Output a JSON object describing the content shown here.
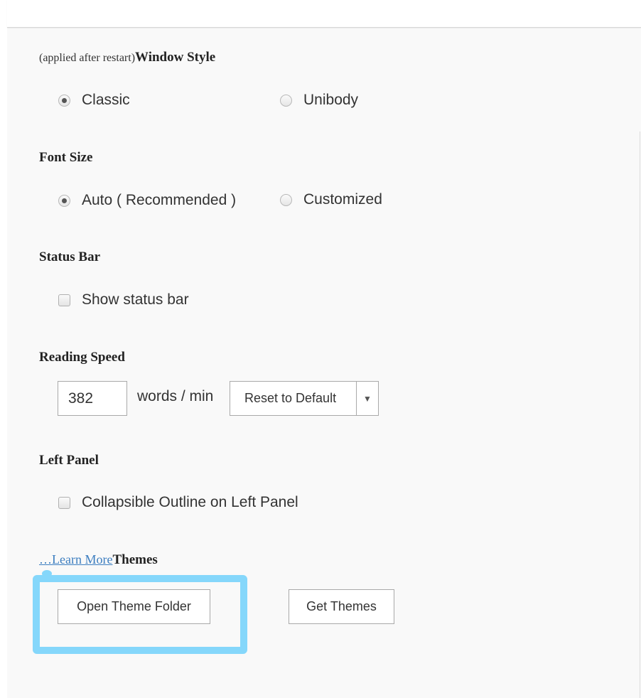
{
  "window_style": {
    "prefix": "(applied after restart)",
    "title": "Window Style",
    "options": [
      {
        "label": "Classic",
        "checked": true
      },
      {
        "label": "Unibody",
        "checked": false
      }
    ]
  },
  "font_size": {
    "title": "Font Size",
    "options": [
      {
        "label": "Auto ( Recommended )",
        "checked": true
      },
      {
        "label": "Customized",
        "checked": false
      }
    ]
  },
  "status_bar": {
    "title": "Status Bar",
    "checkbox_label": "Show status bar",
    "checked": false
  },
  "reading_speed": {
    "title": "Reading Speed",
    "value": "382",
    "unit": "words / min",
    "reset_label": "Reset to Default",
    "arrow": "▼"
  },
  "left_panel": {
    "title": "Left Panel",
    "checkbox_label": "Collapsible Outline on Left Panel",
    "checked": false
  },
  "themes": {
    "link": "…Learn More",
    "title": "Themes",
    "open_folder_label": "Open Theme Folder",
    "get_themes_label": "Get Themes"
  },
  "colors": {
    "highlight": "#85d7fb",
    "link": "#3d7ec0"
  }
}
